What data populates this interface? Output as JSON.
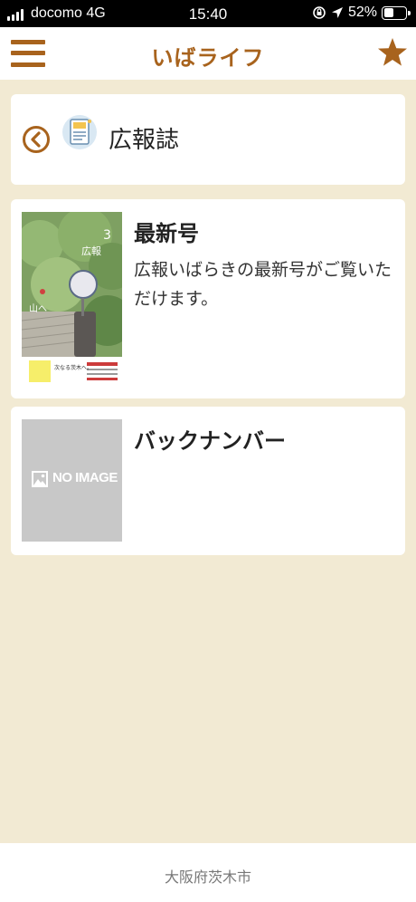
{
  "status_bar": {
    "carrier": "docomo 4G",
    "time": "15:40",
    "battery": "52%",
    "battery_level": 0.52
  },
  "header": {
    "title": "いばライフ"
  },
  "section": {
    "title": "広報誌"
  },
  "items": [
    {
      "title": "最新号",
      "description": "広報いばらきの最新号がご覧いただけます。"
    },
    {
      "title": "バックナンバー",
      "image_placeholder": "NO IMAGE"
    }
  ],
  "cover_text": {
    "issue": "3",
    "label": "広報",
    "side": "山へ",
    "bottom": "次なる茨木へ。"
  },
  "footer": {
    "text": "大阪府茨木市"
  },
  "colors": {
    "accent": "#a8631d",
    "background": "#f2ead3"
  }
}
